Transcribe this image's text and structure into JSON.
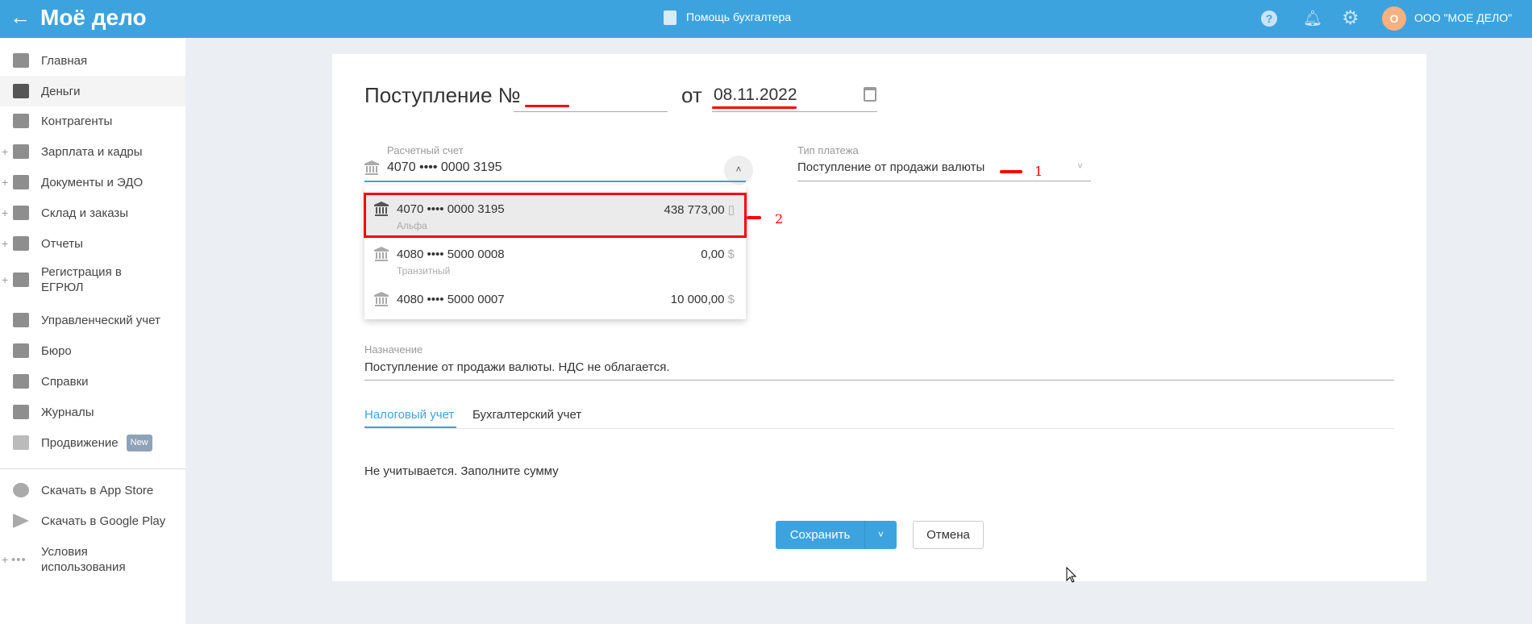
{
  "header": {
    "logo": "Моё дело",
    "help_center": "Помощь бухгалтера",
    "org_avatar": "О",
    "org_name": "ООО \"МОЕ ДЕЛО\""
  },
  "sidebar": {
    "items": [
      {
        "label": "Главная"
      },
      {
        "label": "Деньги"
      },
      {
        "label": "Контрагенты"
      },
      {
        "label": "Зарплата и кадры"
      },
      {
        "label": "Документы и ЭДО"
      },
      {
        "label": "Склад и заказы"
      },
      {
        "label": "Отчеты"
      },
      {
        "label": "Регистрация в ЕГРЮЛ"
      },
      {
        "label": "Управленческий учет"
      },
      {
        "label": "Бюро"
      },
      {
        "label": "Справки"
      },
      {
        "label": "Журналы"
      },
      {
        "label": "Продвижение",
        "badge": "New"
      },
      {
        "label": "Скачать в App Store"
      },
      {
        "label": "Скачать в Google Play"
      },
      {
        "label": "Условия использования"
      }
    ]
  },
  "form": {
    "title": "Поступление №",
    "number": "",
    "date_prefix": "от",
    "date": "08.11.2022",
    "account_label": "Расчетный счет",
    "account_value": "4070 •••• 0000 3195",
    "payment_type_label": "Тип платежа",
    "payment_type_value": "Поступление от продажи валюты",
    "accounts": [
      {
        "number": "4070 •••• 0000 3195",
        "amount": "438 773,00",
        "currency": "▯",
        "bank": "Альфа"
      },
      {
        "number": "4080 •••• 5000 0008",
        "amount": "0,00",
        "currency": "$",
        "bank": "Транзитный"
      },
      {
        "number": "4080 •••• 5000 0007",
        "amount": "10 000,00",
        "currency": "$",
        "bank": ""
      }
    ],
    "purpose_label": "Назначение",
    "purpose_value": "Поступление от продажи валюты. НДС не облагается.",
    "tabs": [
      "Налоговый учет",
      "Бухгалтерский учет"
    ],
    "tax_note": "Не учитывается. Заполните сумму",
    "save": "Сохранить",
    "cancel": "Отмена"
  },
  "annotations": [
    "1",
    "2"
  ],
  "colors": {
    "accent": "#3da3df",
    "annotation": "#ff0000",
    "avatar": "#f7b07e"
  }
}
